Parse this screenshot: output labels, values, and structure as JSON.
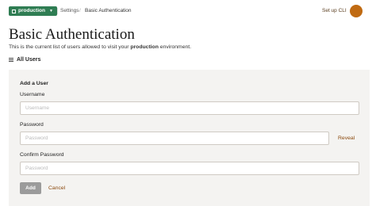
{
  "header": {
    "environment": "production",
    "breadcrumbs": [
      "Settings",
      "Basic Authentication"
    ],
    "breadcrumb_separator": "/",
    "setup_cli": "Set up CLI"
  },
  "page": {
    "title": "Basic Authentication",
    "description_before": "This is the current list of users allowed to visit your ",
    "description_env": "production",
    "description_after": " environment.",
    "all_users": "All Users"
  },
  "form": {
    "heading": "Add a User",
    "username_label": "Username",
    "username_placeholder": "Username",
    "password_label": "Password",
    "password_placeholder": "Password",
    "reveal": "Reveal",
    "confirm_label": "Confirm Password",
    "confirm_placeholder": "Password",
    "add": "Add",
    "cancel": "Cancel"
  },
  "colors": {
    "environment_button": "#2f7d53",
    "link": "#8b4a0e",
    "avatar": "#c06a12"
  },
  "icons": [
    "environment-icon",
    "chevron-down-icon",
    "list-icon"
  ]
}
